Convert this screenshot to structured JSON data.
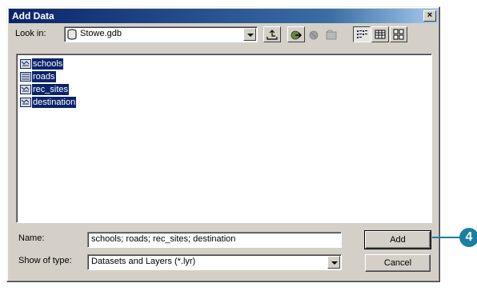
{
  "window": {
    "title": "Add Data",
    "close_glyph": "×"
  },
  "look_in": {
    "label": "Look in:",
    "value": "Stowe.gdb",
    "icon": "database-icon"
  },
  "toolbar": {
    "buttons": [
      "up-one-level-icon",
      "connect-to-folder-icon",
      "disconnect-folder-icon",
      "new-folder-icon",
      "list-view-icon",
      "details-view-icon",
      "thumbnails-view-icon"
    ]
  },
  "file_list": {
    "items": [
      {
        "label": "schools",
        "icon": "feature-class-icon",
        "selected": true
      },
      {
        "label": "roads",
        "icon": "feature-class-icon",
        "selected": true
      },
      {
        "label": "rec_sites",
        "icon": "feature-class-icon",
        "selected": true
      },
      {
        "label": "destination",
        "icon": "feature-class-icon",
        "selected": true
      }
    ]
  },
  "name_field": {
    "label": "Name:",
    "value": "schools; roads; rec_sites; destination"
  },
  "type_field": {
    "label": "Show of type:",
    "value": "Datasets and Layers (*.lyr)"
  },
  "buttons": {
    "add": "Add",
    "cancel": "Cancel"
  },
  "callout": {
    "number": "4"
  },
  "colors": {
    "selection": "#0a246a",
    "title_bar": "#0a246a",
    "dialog_face": "#d4d0c8",
    "callout": "#1b7fa0"
  }
}
